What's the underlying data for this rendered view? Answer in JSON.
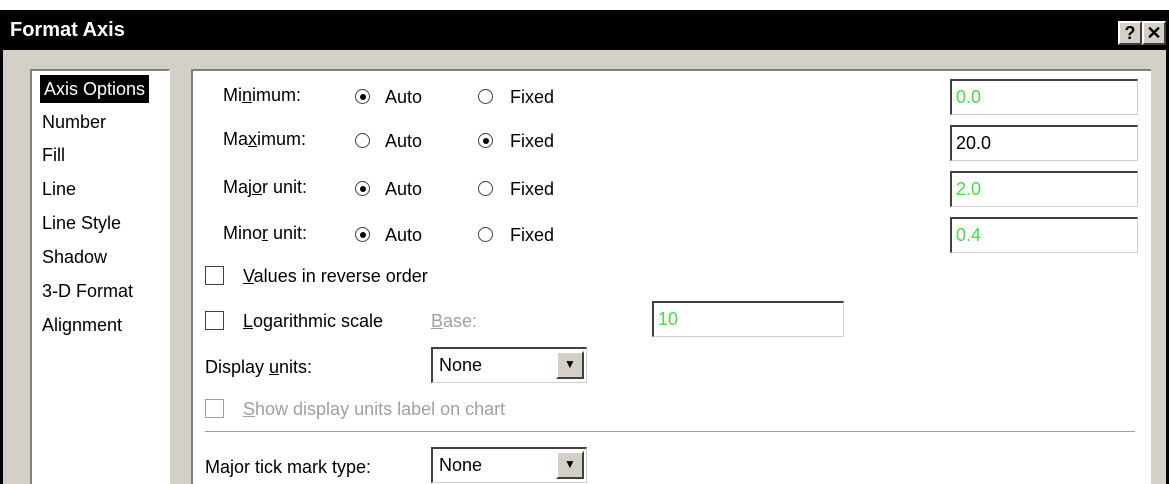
{
  "window": {
    "title": "Format Axis",
    "help_label": "?",
    "close_label": "✕"
  },
  "sidebar": {
    "items": [
      {
        "label": "Axis Options",
        "selected": true
      },
      {
        "label": "Number"
      },
      {
        "label": "Fill"
      },
      {
        "label": "Line"
      },
      {
        "label": "Line Style"
      },
      {
        "label": "Shadow"
      },
      {
        "label": "3-D Format"
      },
      {
        "label": "Alignment"
      }
    ]
  },
  "axis_options": {
    "minimum": {
      "label_pre": "Mi",
      "label_key": "n",
      "label_post": "imum:",
      "selected": "Auto",
      "value": "0.0",
      "value_is_auto": true
    },
    "maximum": {
      "label_pre": "Ma",
      "label_key": "x",
      "label_post": "imum:",
      "selected": "Fixed",
      "value": "20.0",
      "value_is_auto": false
    },
    "major_unit": {
      "label_pre": "Maj",
      "label_key": "o",
      "label_post": "r unit:",
      "selected": "Auto",
      "value": "2.0",
      "value_is_auto": true
    },
    "minor_unit": {
      "label_pre": "Mino",
      "label_key": "r",
      "label_post": " unit:",
      "selected": "Auto",
      "value": "0.4",
      "value_is_auto": true
    },
    "auto_label": "Auto",
    "fixed_label": "Fixed",
    "reverse_order": {
      "label_key": "V",
      "label_rest": "alues in reverse order",
      "checked": false
    },
    "log_scale": {
      "label_key": "L",
      "label_rest": "ogarithmic scale",
      "checked": false,
      "base_label_key": "B",
      "base_label_rest": "ase:",
      "base_value": "10"
    },
    "display_units": {
      "label_pre": "Display ",
      "label_key": "u",
      "label_post": "nits:",
      "value": "None"
    },
    "show_units_label": {
      "label_key": "S",
      "label_rest": "how display units label on chart",
      "checked": false,
      "enabled": false
    },
    "major_tick": {
      "label_pre": "Ma",
      "label_key": "j",
      "label_post": "or tick mark type:",
      "value": "None"
    }
  },
  "colors": {
    "titlebar": "#000000",
    "auto_value_text": "#4cd84c",
    "disabled_text": "#a0a0a0"
  }
}
